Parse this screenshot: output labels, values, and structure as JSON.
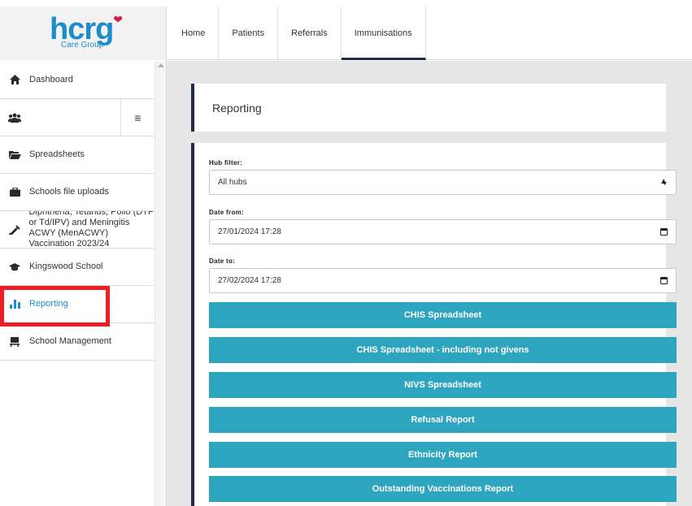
{
  "logo": {
    "text": "hcrg",
    "subtext": "Care Group"
  },
  "top_nav": {
    "tabs": [
      {
        "label": "Home"
      },
      {
        "label": "Patients"
      },
      {
        "label": "Referrals"
      },
      {
        "label": "Immunisations",
        "active": true
      }
    ]
  },
  "sidebar": {
    "items": [
      {
        "icon": "home-icon",
        "label": "Dashboard"
      },
      {
        "icon": "users-icon",
        "label": ""
      },
      {
        "icon": "folder-open-icon",
        "label": "Spreadsheets"
      },
      {
        "icon": "briefcase-icon",
        "label": "Schools file uploads"
      },
      {
        "icon": "syringe-icon",
        "label": "Diphtheria, Tetanus, Polio (DTP or Td/IPV) and Meningitis ACWY (MenACWY) Vaccination 2023/24"
      },
      {
        "icon": "graduation-cap-icon",
        "label": "Kingswood School"
      },
      {
        "icon": "bar-chart-icon",
        "label": "Reporting"
      },
      {
        "icon": "desk-icon",
        "label": "School Management"
      }
    ]
  },
  "main": {
    "header": "Reporting",
    "hub_filter": {
      "label": "Hub filter:",
      "value": "All hubs"
    },
    "date_from": {
      "label": "Date from:",
      "value": "27/01/2024 17:28"
    },
    "date_to": {
      "label": "Date to:",
      "value": "27/02/2024 17:28"
    },
    "buttons": [
      "CHIS Spreadsheet",
      "CHIS Spreadsheet - including not givens",
      "NIVS Spreadsheet",
      "Refusal Report",
      "Ethnicity Report",
      "Outstanding Vaccinations Report"
    ]
  },
  "colors": {
    "accent": "#2ea5be",
    "navy": "#1e2b4a",
    "highlight": "#ee1c25",
    "brand_blue": "#1c8dc9"
  }
}
